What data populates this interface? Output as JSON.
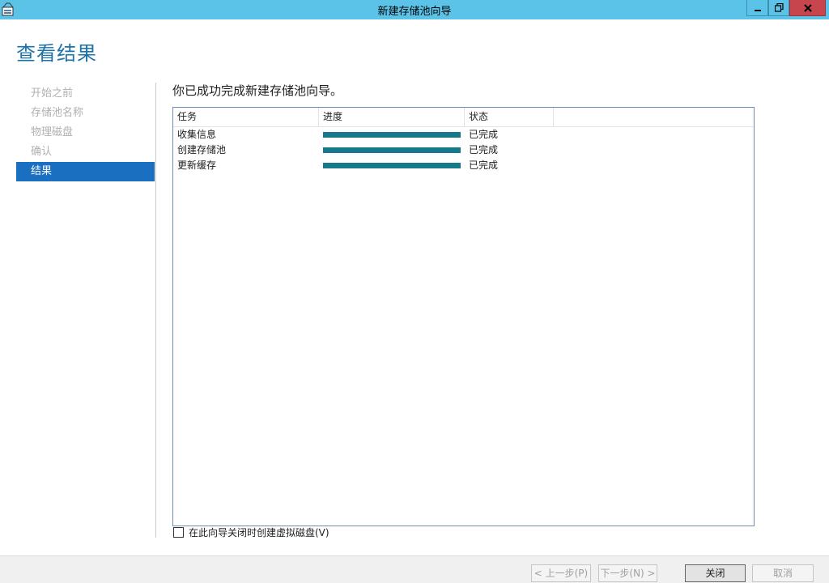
{
  "window": {
    "title": "新建存储池向导",
    "icon": "storage-pool-wizard-icon"
  },
  "page": {
    "title": "查看结果",
    "headline": "你已成功完成新建存储池向导。"
  },
  "nav": {
    "items": [
      {
        "label": "开始之前",
        "active": false
      },
      {
        "label": "存储池名称",
        "active": false
      },
      {
        "label": "物理磁盘",
        "active": false
      },
      {
        "label": "确认",
        "active": false
      },
      {
        "label": "结果",
        "active": true
      }
    ]
  },
  "results": {
    "columns": [
      "任务",
      "进度",
      "状态"
    ],
    "rows": [
      {
        "task": "收集信息",
        "progress": 1.0,
        "status": "已完成"
      },
      {
        "task": "创建存储池",
        "progress": 1.0,
        "status": "已完成"
      },
      {
        "task": "更新缓存",
        "progress": 1.0,
        "status": "已完成"
      }
    ]
  },
  "option": {
    "label": "在此向导关闭时创建虚拟磁盘(V)",
    "checked": false
  },
  "buttons": {
    "prev": "< 上一步(P)",
    "next": "下一步(N) >",
    "close": "关闭",
    "cancel": "取消"
  },
  "colors": {
    "titlebar": "#5bc3e8",
    "accent": "#1c73a8",
    "nav_active": "#1a6fc0",
    "progress": "#167a8b"
  }
}
